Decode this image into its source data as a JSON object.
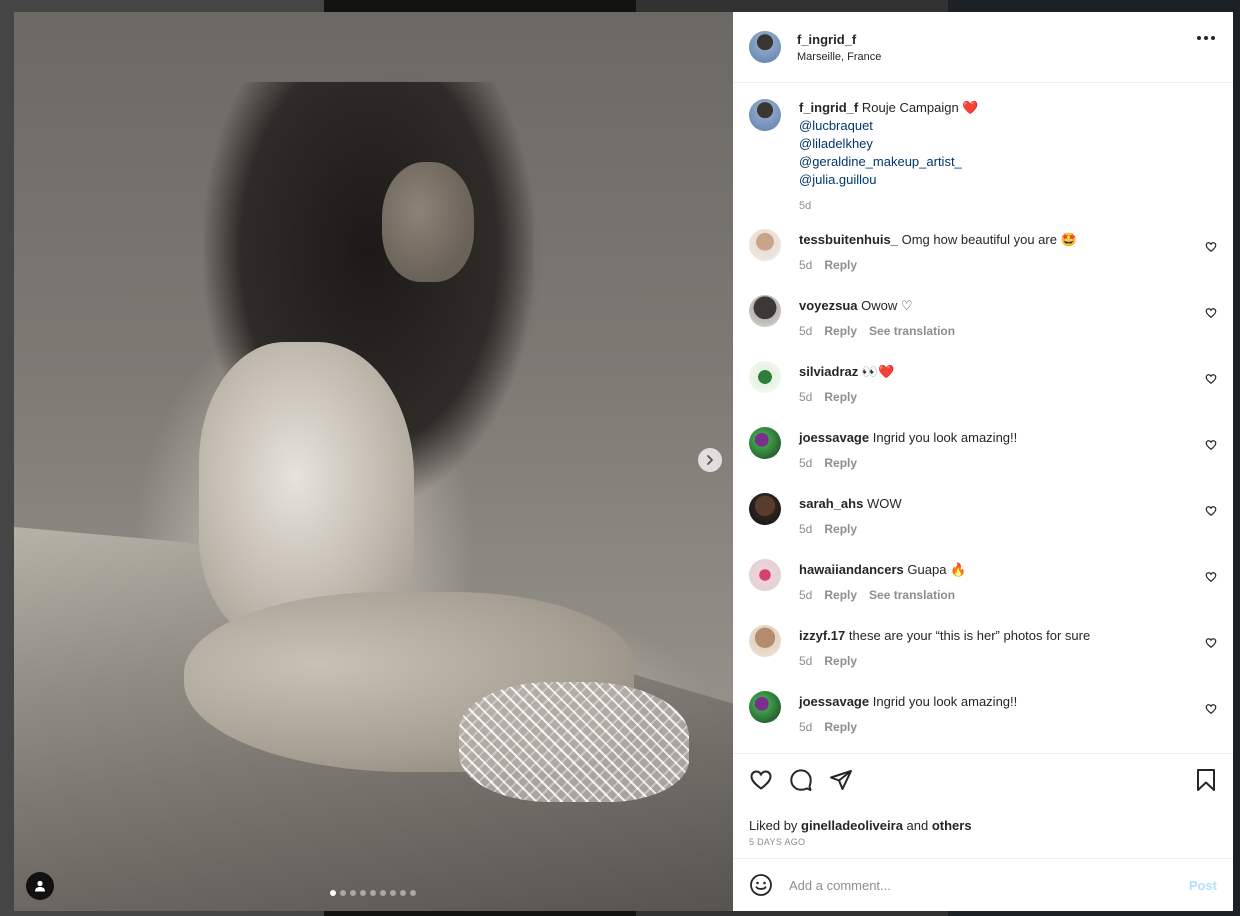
{
  "post": {
    "username": "f_ingrid_f",
    "location": "Marseille, France",
    "caption_text": "Rouje Campaign ❤️",
    "mentions": [
      "@lucbraquet",
      "@liladelkhey",
      "@geraldine_makeup_artist_",
      "@julia.guillou"
    ],
    "caption_time": "5d",
    "carousel_count": 9,
    "carousel_index": 0
  },
  "comments": [
    {
      "username": "tessbuitenhuis_",
      "text": "Omg how beautiful you are 🤩",
      "time": "5d",
      "reply": "Reply",
      "translate": ""
    },
    {
      "username": "voyezsua",
      "text": "Owow ♡",
      "time": "5d",
      "reply": "Reply",
      "translate": "See translation"
    },
    {
      "username": "silviadraz",
      "text": "👀❤️",
      "time": "5d",
      "reply": "Reply",
      "translate": ""
    },
    {
      "username": "joessavage",
      "text": "Ingrid you look amazing!!",
      "time": "5d",
      "reply": "Reply",
      "translate": ""
    },
    {
      "username": "sarah_ahs",
      "text": "WOW",
      "time": "5d",
      "reply": "Reply",
      "translate": ""
    },
    {
      "username": "hawaiiandancers",
      "text": "Guapa 🔥",
      "time": "5d",
      "reply": "Reply",
      "translate": "See translation"
    },
    {
      "username": "izzyf.17",
      "text": "these are your “this is her” photos for sure",
      "time": "5d",
      "reply": "Reply",
      "translate": ""
    },
    {
      "username": "joessavage",
      "text": "Ingrid you look amazing!!",
      "time": "5d",
      "reply": "Reply",
      "translate": ""
    }
  ],
  "likes": {
    "prefix": "Liked by ",
    "user": "ginelladeoliveira",
    "middle": " and ",
    "others": "others",
    "ago": "5 DAYS AGO"
  },
  "add_comment": {
    "placeholder": "Add a comment...",
    "post_label": "Post"
  },
  "icons": {
    "more": "more-horizontal-icon",
    "next": "chevron-right-icon",
    "tag": "user-tag-icon",
    "like": "heart-icon",
    "comment": "comment-bubble-icon",
    "share": "paper-plane-icon",
    "save": "bookmark-icon",
    "emoji": "emoji-smile-icon"
  },
  "colors": {
    "link": "#00376b",
    "muted": "#8e8e8e",
    "post_disabled": "#b2dffc",
    "text": "#262626"
  }
}
